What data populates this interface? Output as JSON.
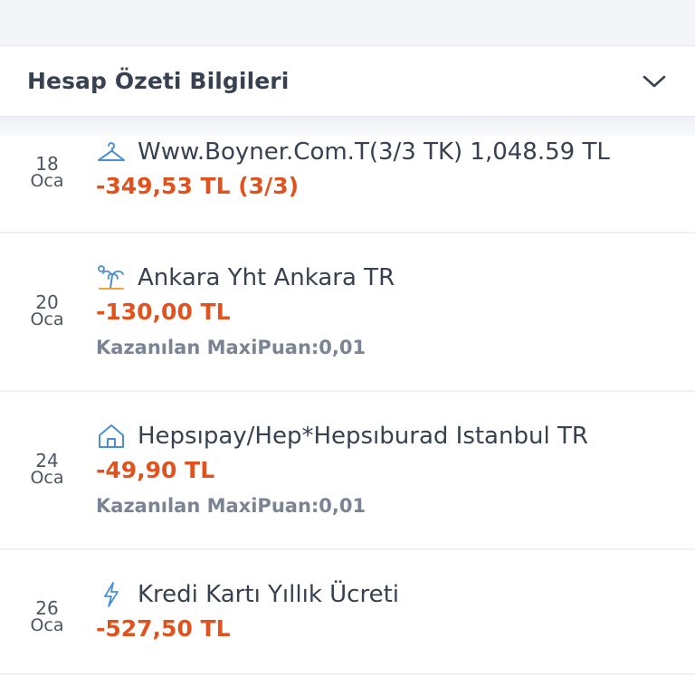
{
  "header": {
    "title": "Hesap Özeti Bilgileri",
    "expand_icon": "chevron-down-icon"
  },
  "colors": {
    "amount": "#e0531f",
    "icon": "#4a8fd1",
    "muted": "#7b8494"
  },
  "transactions": [
    {
      "day": "18",
      "month": "Oca",
      "icon": "hanger-icon",
      "merchant": "Www.Boyner.Com.T(3/3 TK) 1,048.59 TL",
      "amount": "-349,53 TL (3/3)",
      "points": ""
    },
    {
      "day": "20",
      "month": "Oca",
      "icon": "palm-tree-icon",
      "merchant": "Ankara Yht Ankara TR",
      "amount": "-130,00 TL",
      "points": "Kazanılan MaxiPuan:0,01"
    },
    {
      "day": "24",
      "month": "Oca",
      "icon": "home-icon",
      "merchant": "Hepsıpay/Hep*Hepsıburad Istanbul TR",
      "amount": "-49,90 TL",
      "points": "Kazanılan MaxiPuan:0,01"
    },
    {
      "day": "26",
      "month": "Oca",
      "icon": "lightning-icon",
      "merchant": "Kredi Kartı Yıllık Ücreti",
      "amount": "-527,50 TL",
      "points": ""
    }
  ]
}
